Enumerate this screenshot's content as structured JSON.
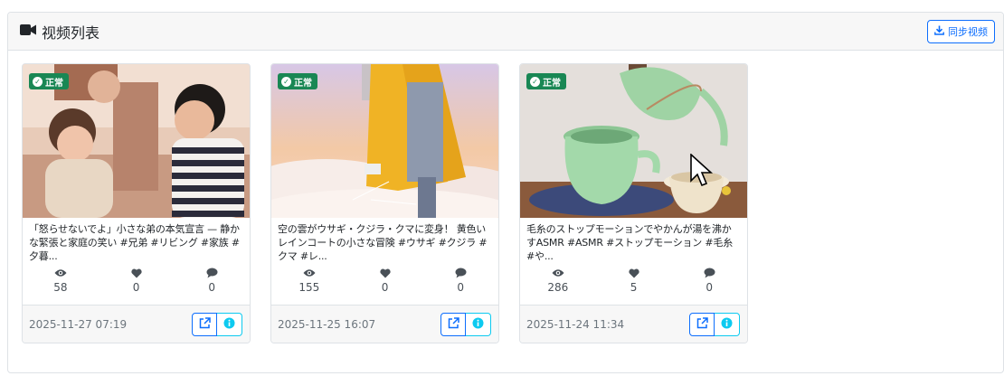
{
  "header": {
    "title": "视频列表",
    "sync_label": "同步视频",
    "title_icon": "video-camera-icon",
    "sync_icon": "download-icon"
  },
  "status_label": "正常",
  "colors": {
    "primary": "#0d6efd",
    "success": "#198754",
    "info": "#0dcaf0",
    "stat_icon": "#495057"
  },
  "videos": [
    {
      "description": "「怒らせないでよ」小さな弟の本気宣言 — 静かな緊張と家庭の笑い #兄弟 #リビング #家族 #夕暮...",
      "views": "58",
      "likes": "0",
      "comments": "0",
      "date": "2025-11-27 07:19"
    },
    {
      "description": "空の雲がウサギ・クジラ・クマに変身！ 黄色いレインコートの小さな冒険 #ウサギ #クジラ #クマ #レ...",
      "views": "155",
      "likes": "0",
      "comments": "0",
      "date": "2025-11-25 16:07"
    },
    {
      "description": "毛糸のストップモーションでやかんが湯を沸かすASMR #ASMR #ストップモーション #毛糸 #や...",
      "views": "286",
      "likes": "5",
      "comments": "0",
      "date": "2025-11-24 11:34"
    }
  ]
}
